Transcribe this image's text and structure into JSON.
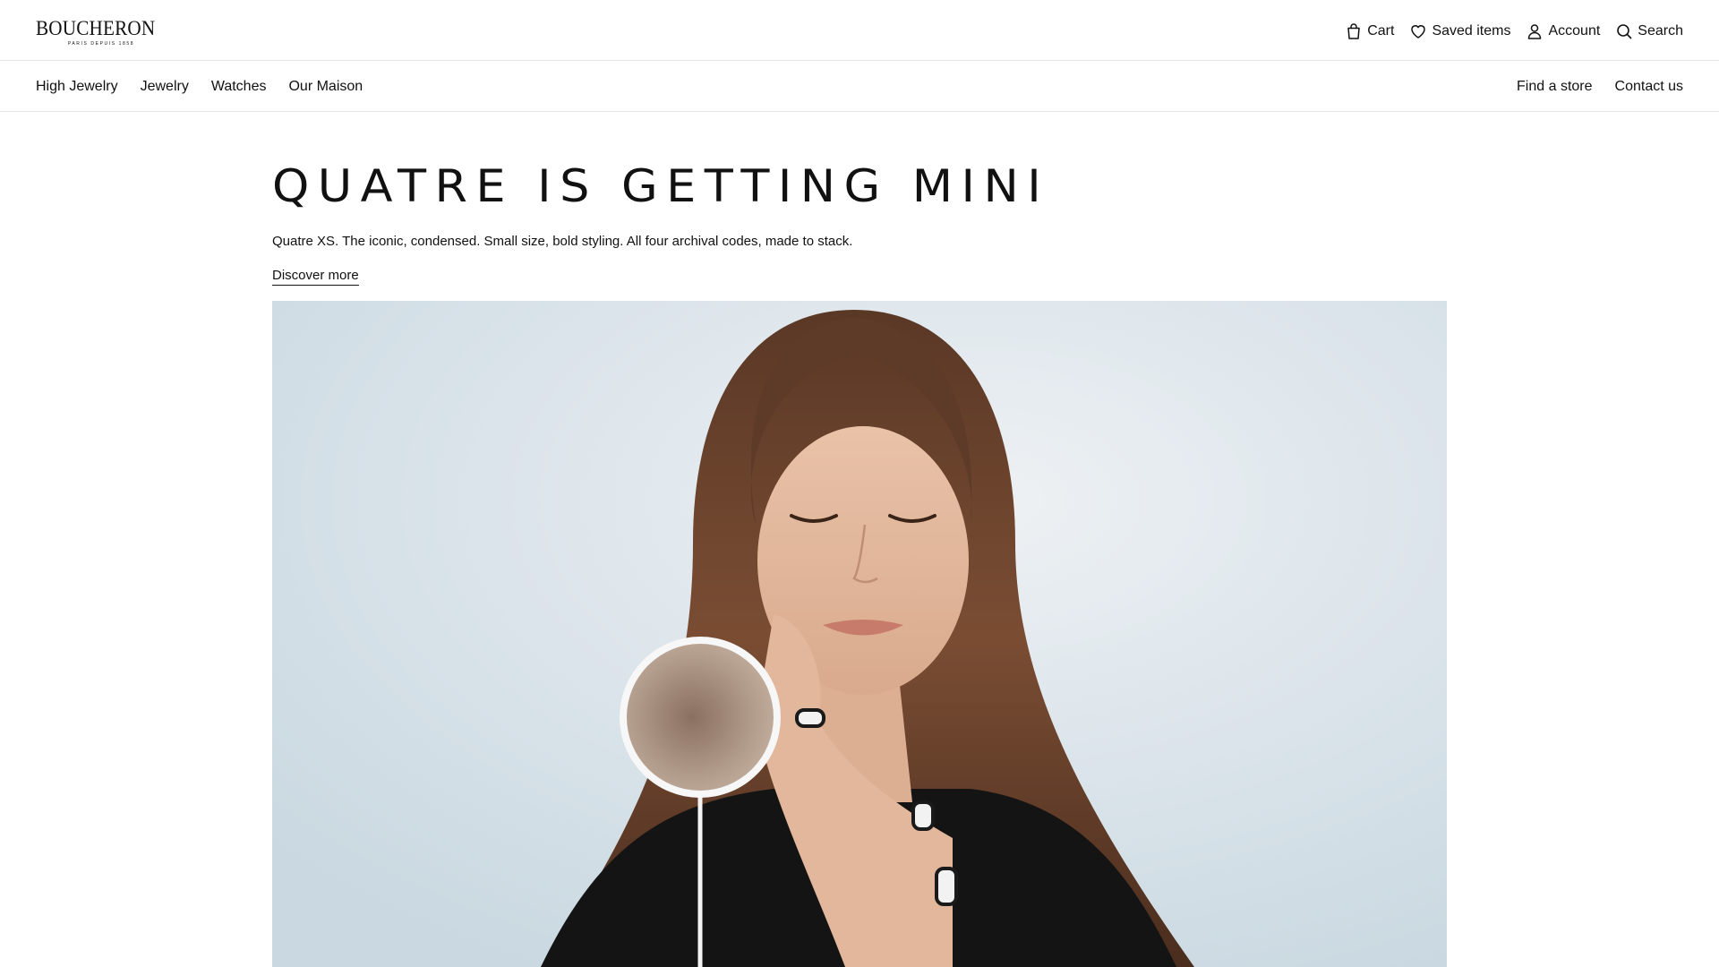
{
  "header": {
    "logo_text": "BOUCHERON",
    "logo_tagline": "PARIS DEPUIS 1858",
    "utility": [
      {
        "label": "Cart",
        "icon": "bag-icon"
      },
      {
        "label": "Saved items",
        "icon": "heart-icon"
      },
      {
        "label": "Account",
        "icon": "user-icon"
      },
      {
        "label": "Search",
        "icon": "search-icon"
      }
    ]
  },
  "nav": {
    "left": [
      "High Jewelry",
      "Jewelry",
      "Watches",
      "Our Maison"
    ],
    "right": [
      "Find a store",
      "Contact us"
    ]
  },
  "hero": {
    "title": "QUATRE IS GETTING MINI",
    "subtitle": "Quatre XS. The iconic, condensed. Small size, bold styling. All four archival codes, made to stack.",
    "cta": "Discover more",
    "image_alt": "Woman with eyes closed holding a small round mirror, wearing Quatre rings"
  },
  "colors": {
    "text": "#111111",
    "divider": "#e4e4e4",
    "background": "#ffffff",
    "hero_bg": "#dfe6ec"
  }
}
